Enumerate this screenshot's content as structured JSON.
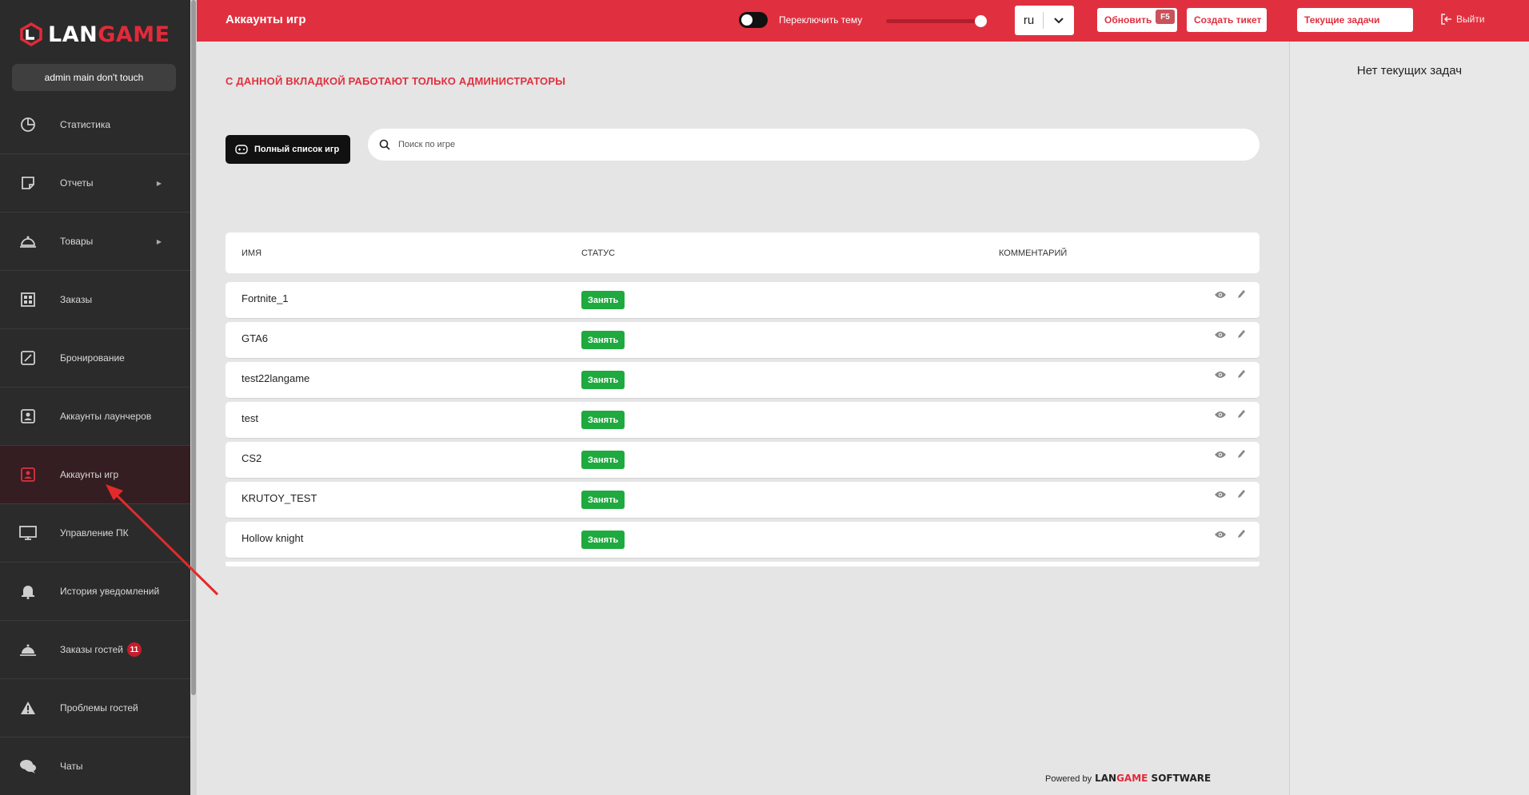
{
  "app": {
    "logo_text_a": "LAN",
    "logo_text_b": "GAME",
    "user": "admin main don't touch"
  },
  "sidebar": {
    "items": [
      {
        "label": "Статистика",
        "icon": "pie-chart-icon"
      },
      {
        "label": "Отчеты",
        "icon": "note-icon",
        "has_submenu": true
      },
      {
        "label": "Товары",
        "icon": "cloche-icon",
        "has_submenu": true
      },
      {
        "label": "Заказы",
        "icon": "grid-icon"
      },
      {
        "label": "Бронирование",
        "icon": "edit-square-icon"
      },
      {
        "label": "Аккаунты лаунчеров",
        "icon": "contact-icon"
      },
      {
        "label": "Аккаунты игр",
        "icon": "contact-icon",
        "active": true
      },
      {
        "label": "Управление ПК",
        "icon": "monitor-icon"
      },
      {
        "label": "История уведомлений",
        "icon": "bell-icon"
      },
      {
        "label": "Заказы гостей",
        "icon": "cloche-icon",
        "badge": "11"
      },
      {
        "label": "Проблемы гостей",
        "icon": "warning-icon"
      },
      {
        "label": "Чаты",
        "icon": "chat-icon"
      }
    ]
  },
  "header": {
    "title": "Аккаунты игр",
    "toggle_label": "Переключить тему",
    "language": "ru",
    "refresh_label": "Обновить",
    "refresh_key": "F5",
    "ticket_label": "Создать тикет",
    "tasks_label": "Текущие задачи",
    "logout_label": "Выйти"
  },
  "main": {
    "warning": "С ДАННОЙ ВКЛАДКОЙ РАБОТАЮТ ТОЛЬКО АДМИНИСТРАТОРЫ",
    "full_list_label": "Полный список игр",
    "search_placeholder": "Поиск по игре",
    "columns": {
      "name": "ИМЯ",
      "status": "СТАТУС",
      "comment": "КОММЕНТАРИЙ"
    },
    "rows": [
      {
        "name": "Fortnite_1",
        "status": "Занять"
      },
      {
        "name": "GTA6",
        "status": "Занять"
      },
      {
        "name": "test22langame",
        "status": "Занять"
      },
      {
        "name": "test",
        "status": "Занять"
      },
      {
        "name": "CS2",
        "status": "Занять"
      },
      {
        "name": "KRUTOY_TEST",
        "status": "Занять"
      },
      {
        "name": "Hollow knight",
        "status": "Занять"
      }
    ]
  },
  "footer": {
    "powered_by": "Powered by",
    "brand_a": "LAN",
    "brand_b": "GAME",
    "brand_c": "SOFTWARE"
  },
  "right_panel": {
    "empty_text": "Нет текущих задач"
  },
  "colors": {
    "accent": "#e0303f",
    "sidebar_bg": "#2b2b2b",
    "status_green": "#1eaa3e"
  }
}
